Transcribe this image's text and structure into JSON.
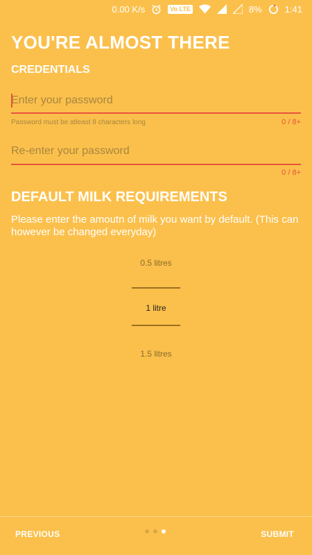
{
  "status_bar": {
    "network_speed": "0.00 K/s",
    "volte_badge": "Vo LTE",
    "battery": "8%",
    "time": "1:41",
    "icons": [
      "alarm-icon",
      "wifi-icon",
      "signal-icon",
      "signal-empty-icon",
      "battery-ring-icon"
    ]
  },
  "header": {
    "title": "YOU'RE ALMOST THERE"
  },
  "credentials": {
    "section_title": "CREDENTIALS",
    "password": {
      "value": "",
      "placeholder": "Enter your password",
      "helper": "Password must be atleast 8 characters long",
      "counter": "0 / 8+"
    },
    "confirm_password": {
      "value": "",
      "placeholder": "Re-enter your password",
      "counter": "0 / 8+"
    }
  },
  "milk": {
    "section_title": "DEFAULT MILK REQUIREMENTS",
    "description": "Please enter the amoutn of milk you want by default. (This can however be changed everyday)",
    "options": [
      "0.5 litres",
      "1 litre",
      "1.5 litres"
    ],
    "selected": "1 litre"
  },
  "footer": {
    "previous_label": "PREVIOUS",
    "submit_label": "SUBMIT",
    "page_count": 3,
    "current_page": 3
  },
  "colors": {
    "background": "#FBC04C",
    "accent_error": "#E8523B",
    "picker_line": "#9A6F1F"
  }
}
